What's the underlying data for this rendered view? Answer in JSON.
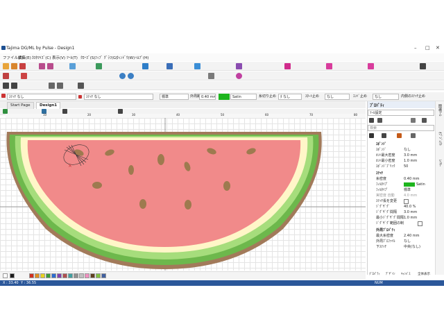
{
  "app": {
    "title": "Tajima DG/ML by Pulse - Design1"
  },
  "menu": [
    "ファイル(F)",
    "編集(E)",
    "ｶｽﾀﾏｲｽﾞ(C)",
    "表示(V)",
    "ﾂｰﾙ(T)",
    "ｸﾛｰｽﾞ(S)",
    "ﾌｨﾌﾞ ｸﾞﾗﾌ(G)",
    "ｳｨﾝﾄﾞｳ(W)",
    "ﾍﾙﾌﾟ(H)"
  ],
  "toolbar3": {
    "stitch_type": "ｽﾃｯﾁ なし",
    "fill_type": "ｽﾃｯﾁ なし",
    "standard": "標準",
    "outline_label": "外周距離",
    "outline_value": "0.40 mm",
    "satin": "Satin",
    "trim_label": "糸切り止め",
    "trim_value": "ﾀ なし",
    "start_label": "ｽﾀｰﾄ止め",
    "start_value": "なし",
    "end_label": "ｴﾝﾄﾞ止め",
    "end_value": "なし",
    "inner_label": "内側のｽﾃｯﾁ止め"
  },
  "tabs": [
    "Start Page",
    "Design1"
  ],
  "ruler": {
    "h": [
      "10",
      "20",
      "30",
      "40",
      "50",
      "60",
      "70",
      "80"
    ]
  },
  "panel": {
    "title": "ﾌﾟﾛﾊﾟﾃｨ",
    "selector": "ﾂｰﾙ設定",
    "search": "検索",
    "rows": [
      {
        "k": "ｽﾎﾟﾝｼﾞ",
        "v": "",
        "sec": true
      },
      {
        "k": "ｽﾎﾟﾝｼﾞ",
        "v": "なし"
      },
      {
        "k": "ｶﾝﾄ最大密度",
        "v": "3.0 mm"
      },
      {
        "k": "ｶﾝﾄ最小密度",
        "v": "1.0 mm"
      },
      {
        "k": "ｽﾎﾟﾝｼﾞﾌﾞﾘｯｸ",
        "v": "50"
      },
      {
        "k": "ｽﾃｯﾁ",
        "v": "",
        "sec": true
      },
      {
        "k": "糸密度",
        "v": "0.40 mm"
      },
      {
        "k": "ﾌｨﾙﾀｲﾌﾟ",
        "v": "Satin"
      },
      {
        "k": "ﾌｨﾙﾀｲﾌﾟ",
        "v": "標準"
      },
      {
        "k": "実密度 自動",
        "v": "4.0 mm"
      },
      {
        "k": "ｽﾃｯﾁ長を変更",
        "v": ""
      },
      {
        "k": "ｼﾞｸﾞｻﾞｸﾞ",
        "v": "40.0 %"
      },
      {
        "k": "ｼﾞｸﾞｻﾞｸﾞ間隔",
        "v": "3.0 mm"
      },
      {
        "k": "最小ｼﾞｸﾞｻﾞｸﾞ間隔",
        "v": "1.0 mm"
      },
      {
        "k": "ｼﾞｸﾞｻﾞｸﾞ範囲の制",
        "v": ""
      },
      {
        "k": "外周ﾌﾟﾛﾊﾟﾃｨ",
        "v": "",
        "sec": true
      },
      {
        "k": "最大糸密度",
        "v": "2.40 mm"
      },
      {
        "k": "外周ﾌﾟﾛﾌｧｲﾙ",
        "v": "なし"
      },
      {
        "k": "下ｽﾃｯﾁ",
        "v": "中央(なし)"
      }
    ],
    "footer": [
      "ﾌﾟﾛﾊﾟﾃｨ",
      "ﾃﾞｻﾞｲﾝ",
      "ｷｬﾝﾊﾞｽ",
      "全体表示"
    ]
  },
  "side_tabs": [
    "関連ﾂｰﾙ",
    "ｵﾌﾞｼﾞｪｸﾄ",
    "ﾚｲﾔｰ"
  ],
  "status": {
    "x": "X : 33.40",
    "y": "Y : 36.55",
    "num": "NUM"
  },
  "colors": {
    "flesh": "#f18a8a",
    "rind_light": "#fff6c8",
    "rind_green": "#a6dd7c",
    "rind_outer": "#6db84c",
    "border": "#a27a5a",
    "seed": "#9e7a4f",
    "satin": "#1db51d",
    "accent": "#2b579a"
  },
  "palette": [
    "#ffffff",
    "#1b1b1b",
    "#d03020",
    "#e09020",
    "#e8d020",
    "#3a9a3a",
    "#2b6bd0",
    "#8040b0",
    "#b05050",
    "#40a0a0",
    "#909090",
    "#c0c0c0",
    "#f090c0",
    "#604020",
    "#80c040",
    "#4060a0"
  ]
}
